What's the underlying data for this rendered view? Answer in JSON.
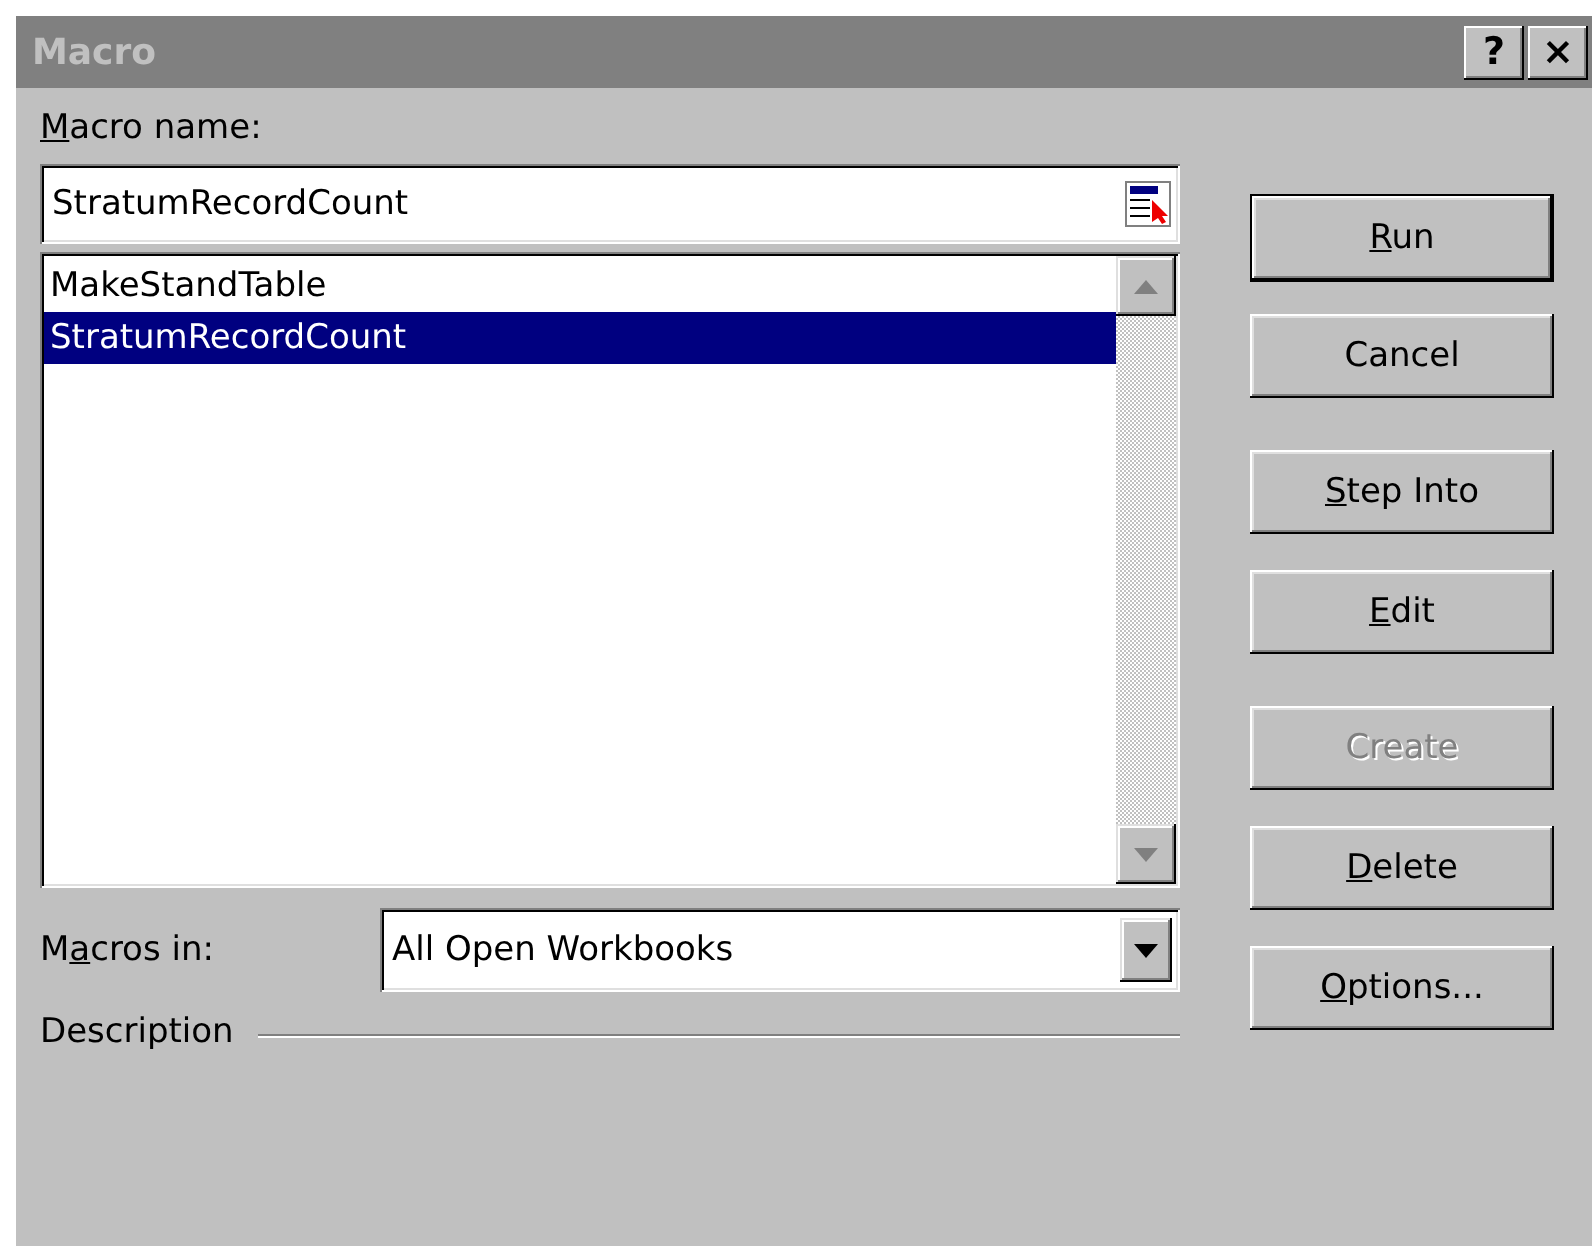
{
  "window": {
    "title": "Macro",
    "title_buttons": [
      "?",
      "×"
    ]
  },
  "macro_name": {
    "label": {
      "key": "M",
      "post": "acro name:"
    },
    "value": "StratumRecordCount"
  },
  "macros": [
    {
      "name": "MakeStandTable",
      "selected": false
    },
    {
      "name": "StratumRecordCount",
      "selected": true
    }
  ],
  "buttons": [
    {
      "label": {
        "key": "R",
        "post": "un"
      },
      "default": true,
      "disabled": false
    },
    {
      "label": {
        "pre": "Cancel"
      },
      "default": false,
      "disabled": false
    },
    {
      "label": {
        "key": "S",
        "post": "tep Into"
      },
      "default": false,
      "disabled": false
    },
    {
      "label": {
        "key": "E",
        "post": "dit"
      },
      "default": false,
      "disabled": false
    },
    {
      "label": {
        "pre": "Create"
      },
      "default": false,
      "disabled": true
    },
    {
      "label": {
        "key": "D",
        "post": "elete"
      },
      "default": false,
      "disabled": false
    },
    {
      "label": {
        "key": "O",
        "post": "ptions..."
      },
      "default": false,
      "disabled": false
    }
  ],
  "macros_in": {
    "label": {
      "pre": "M",
      "key": "a",
      "post": "cros in:"
    },
    "value": "All Open Workbooks"
  },
  "description": {
    "label": "Description"
  }
}
